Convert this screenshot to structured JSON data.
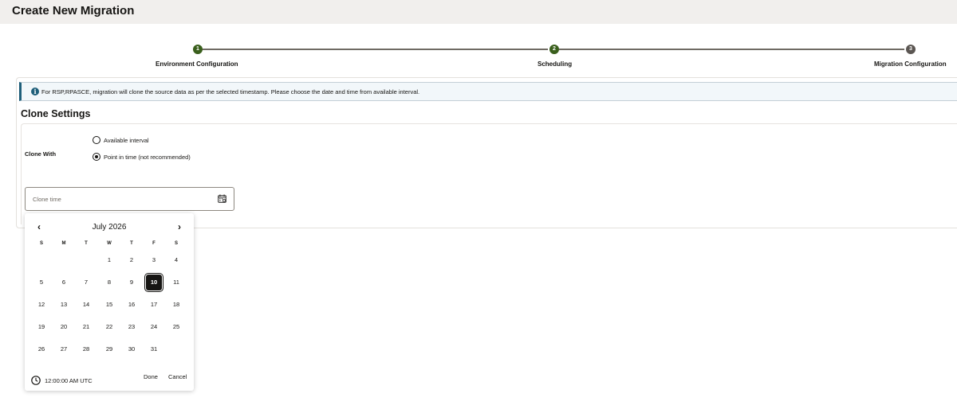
{
  "header": {
    "title": "Create New Migration"
  },
  "train": {
    "steps": [
      {
        "number": "1",
        "label": "Environment Configuration",
        "state": "done"
      },
      {
        "number": "2",
        "label": "Scheduling",
        "state": "done"
      },
      {
        "number": "3",
        "label": "Migration Configuration",
        "state": "pending"
      }
    ]
  },
  "banner": {
    "icon": "info-icon",
    "text": "For RSP,RPASCE, migration will clone the source data as per the selected timestamp. Please choose the date and time from available interval."
  },
  "clone_settings": {
    "title": "Clone Settings",
    "clone_with_label": "Clone With",
    "options": [
      {
        "label": "Available interval",
        "checked": false
      },
      {
        "label": "Point in time (not recommended)",
        "checked": true
      }
    ],
    "clone_time_placeholder": "Clone time"
  },
  "datepicker": {
    "prev": "‹",
    "next": "›",
    "month": "July 2026",
    "dow": [
      "S",
      "M",
      "T",
      "W",
      "T",
      "F",
      "S"
    ],
    "weeks": [
      [
        "",
        "",
        "",
        "1",
        "2",
        "3",
        "4"
      ],
      [
        "5",
        "6",
        "7",
        "8",
        "9",
        "10",
        "11"
      ],
      [
        "12",
        "13",
        "14",
        "15",
        "16",
        "17",
        "18"
      ],
      [
        "19",
        "20",
        "21",
        "22",
        "23",
        "24",
        "25"
      ],
      [
        "26",
        "27",
        "28",
        "29",
        "30",
        "31",
        ""
      ]
    ],
    "selected": "10",
    "time": "12:00:00 AM UTC",
    "done_label": "Done",
    "cancel_label": "Cancel"
  },
  "colors": {
    "accent_done": "#3a5f1c",
    "pending": "#5b5652",
    "info": "#1f5f7a"
  }
}
